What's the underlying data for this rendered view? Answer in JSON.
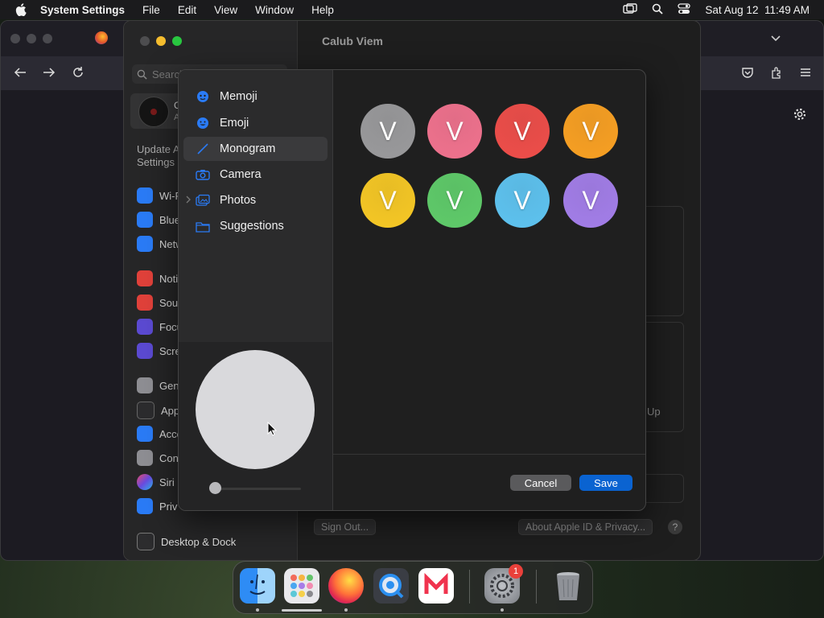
{
  "menubar": {
    "app": "System Settings",
    "menus": [
      "File",
      "Edit",
      "View",
      "Window",
      "Help"
    ],
    "datetime": "Sat Aug 12  11:49 AM"
  },
  "settings": {
    "title": "Calub Viem",
    "search_placeholder": "Search",
    "account_initial": "C",
    "account_sub": "A",
    "update_text": "Update A\nSettings",
    "sidebar": [
      {
        "label": "Wi-F",
        "color": "#2a7bf6"
      },
      {
        "label": "Blue",
        "color": "#2a7bf6"
      },
      {
        "label": "Netw",
        "color": "#2a7bf6"
      },
      {
        "label": "Noti",
        "color": "#e0413a"
      },
      {
        "label": "Sou",
        "color": "#e0413a"
      },
      {
        "label": "Focu",
        "color": "#5b4ad1"
      },
      {
        "label": "Scre",
        "color": "#5b4ad1"
      },
      {
        "label": "Gen",
        "color": "#8e8e93"
      },
      {
        "label": "App",
        "color": "#2c2c2e"
      },
      {
        "label": "Acce",
        "color": "#2a7bf6"
      },
      {
        "label": "Con",
        "color": "#8e8e93"
      },
      {
        "label": "Siri",
        "color": "#b04ad8"
      },
      {
        "label": "Priv",
        "color": "#2a7bf6"
      }
    ],
    "desktop_dock": "Desktop & Dock",
    "setup_text": "Up",
    "sign_out": "Sign Out...",
    "about_privacy": "About Apple ID & Privacy...",
    "help": "?"
  },
  "dialog": {
    "items": [
      {
        "label": "Memoji",
        "icon": "memoji-icon"
      },
      {
        "label": "Emoji",
        "icon": "emoji-icon"
      },
      {
        "label": "Monogram",
        "icon": "pencil-icon",
        "selected": true
      },
      {
        "label": "Camera",
        "icon": "camera-icon"
      },
      {
        "label": "Photos",
        "icon": "photos-icon"
      },
      {
        "label": "Suggestions",
        "icon": "folder-icon"
      }
    ],
    "monogram_letter": "V",
    "monogram_colors": [
      "#9a9a9c",
      "#f0728e",
      "#ee4e4a",
      "#f8a023",
      "#f6c825",
      "#5fcb6a",
      "#5ec3f0",
      "#a37ee9"
    ],
    "preview_color": "#d9d9dc",
    "slider_fraction": 0,
    "cancel": "Cancel",
    "save": "Save",
    "accent": "#0a63d1"
  },
  "dock": {
    "apps": [
      "Finder",
      "Launchpad",
      "Firefox",
      "QuickTime Player",
      "News",
      "System Settings",
      "Trash"
    ],
    "badge": "1"
  }
}
